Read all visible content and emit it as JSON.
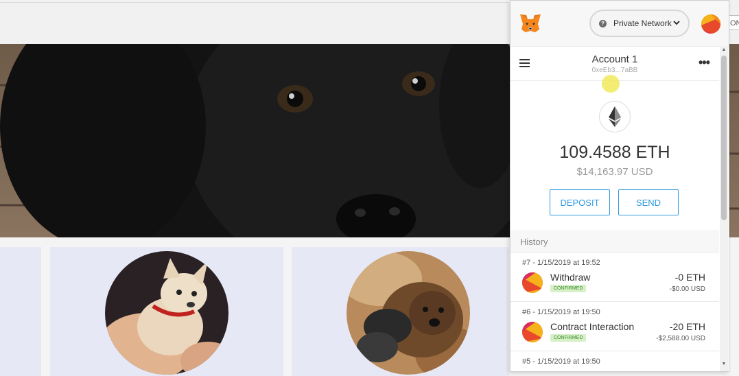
{
  "browser": {
    "toolbar_partial_label": "ON"
  },
  "metamask": {
    "network_label": "Private Network",
    "account": {
      "name": "Account 1",
      "address": "0xeEb3...7aBB"
    },
    "balance": {
      "eth": "109.4588 ETH",
      "usd": "$14,163.97 USD"
    },
    "buttons": {
      "deposit": "DEPOSIT",
      "send": "SEND"
    },
    "history": {
      "title": "History",
      "items": [
        {
          "date": "#7 - 1/15/2019 at 19:52",
          "name": "Withdraw",
          "status": "CONFIRMED",
          "eth": "-0 ETH",
          "usd": "-$0.00 USD"
        },
        {
          "date": "#6 - 1/15/2019 at 19:50",
          "name": "Contract Interaction",
          "status": "CONFIRMED",
          "eth": "-20 ETH",
          "usd": "-$2,588.00 USD"
        },
        {
          "date": "#5 - 1/15/2019 at 19:50"
        }
      ]
    },
    "icons": [
      "metamask-fox-icon",
      "question-icon",
      "chevron-down-icon",
      "account-avatar-icon",
      "hamburger-icon",
      "more-dots-icon",
      "ethereum-icon"
    ],
    "colors": {
      "accent": "#2f9ae0",
      "confirmed_bg": "#d6f0c8",
      "confirmed_text": "#3c8a2a"
    }
  }
}
